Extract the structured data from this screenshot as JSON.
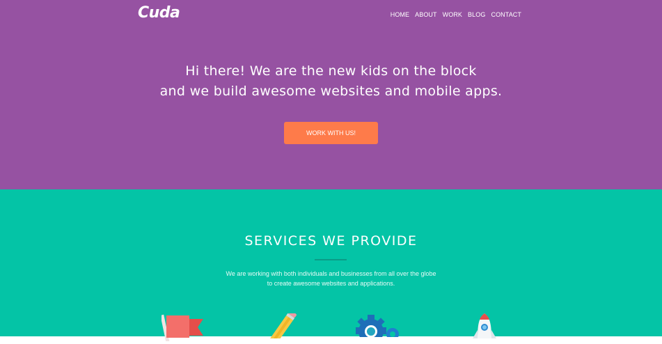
{
  "brand": {
    "logo": "Cuda"
  },
  "nav": {
    "items": [
      "HOME",
      "ABOUT",
      "WORK",
      "BLOG",
      "CONTACT"
    ]
  },
  "hero": {
    "line1": "Hi there! We are the new kids on the block",
    "line2": "and we build awesome websites and mobile apps.",
    "cta_label": "WORK WITH US!"
  },
  "services": {
    "title": "SERVICES WE PROVIDE",
    "desc_line1": "We are working with both individuals and businesses from all over the globe",
    "desc_line2": "to create awesome websites and applications.",
    "icons": [
      "flag-icon",
      "pencil-icon",
      "gear-icon",
      "rocket-icon"
    ]
  },
  "colors": {
    "hero_bg": "#9652a2",
    "services_bg": "#04c4a6",
    "cta_bg": "#fe7b4a",
    "text": "#ffffff"
  }
}
